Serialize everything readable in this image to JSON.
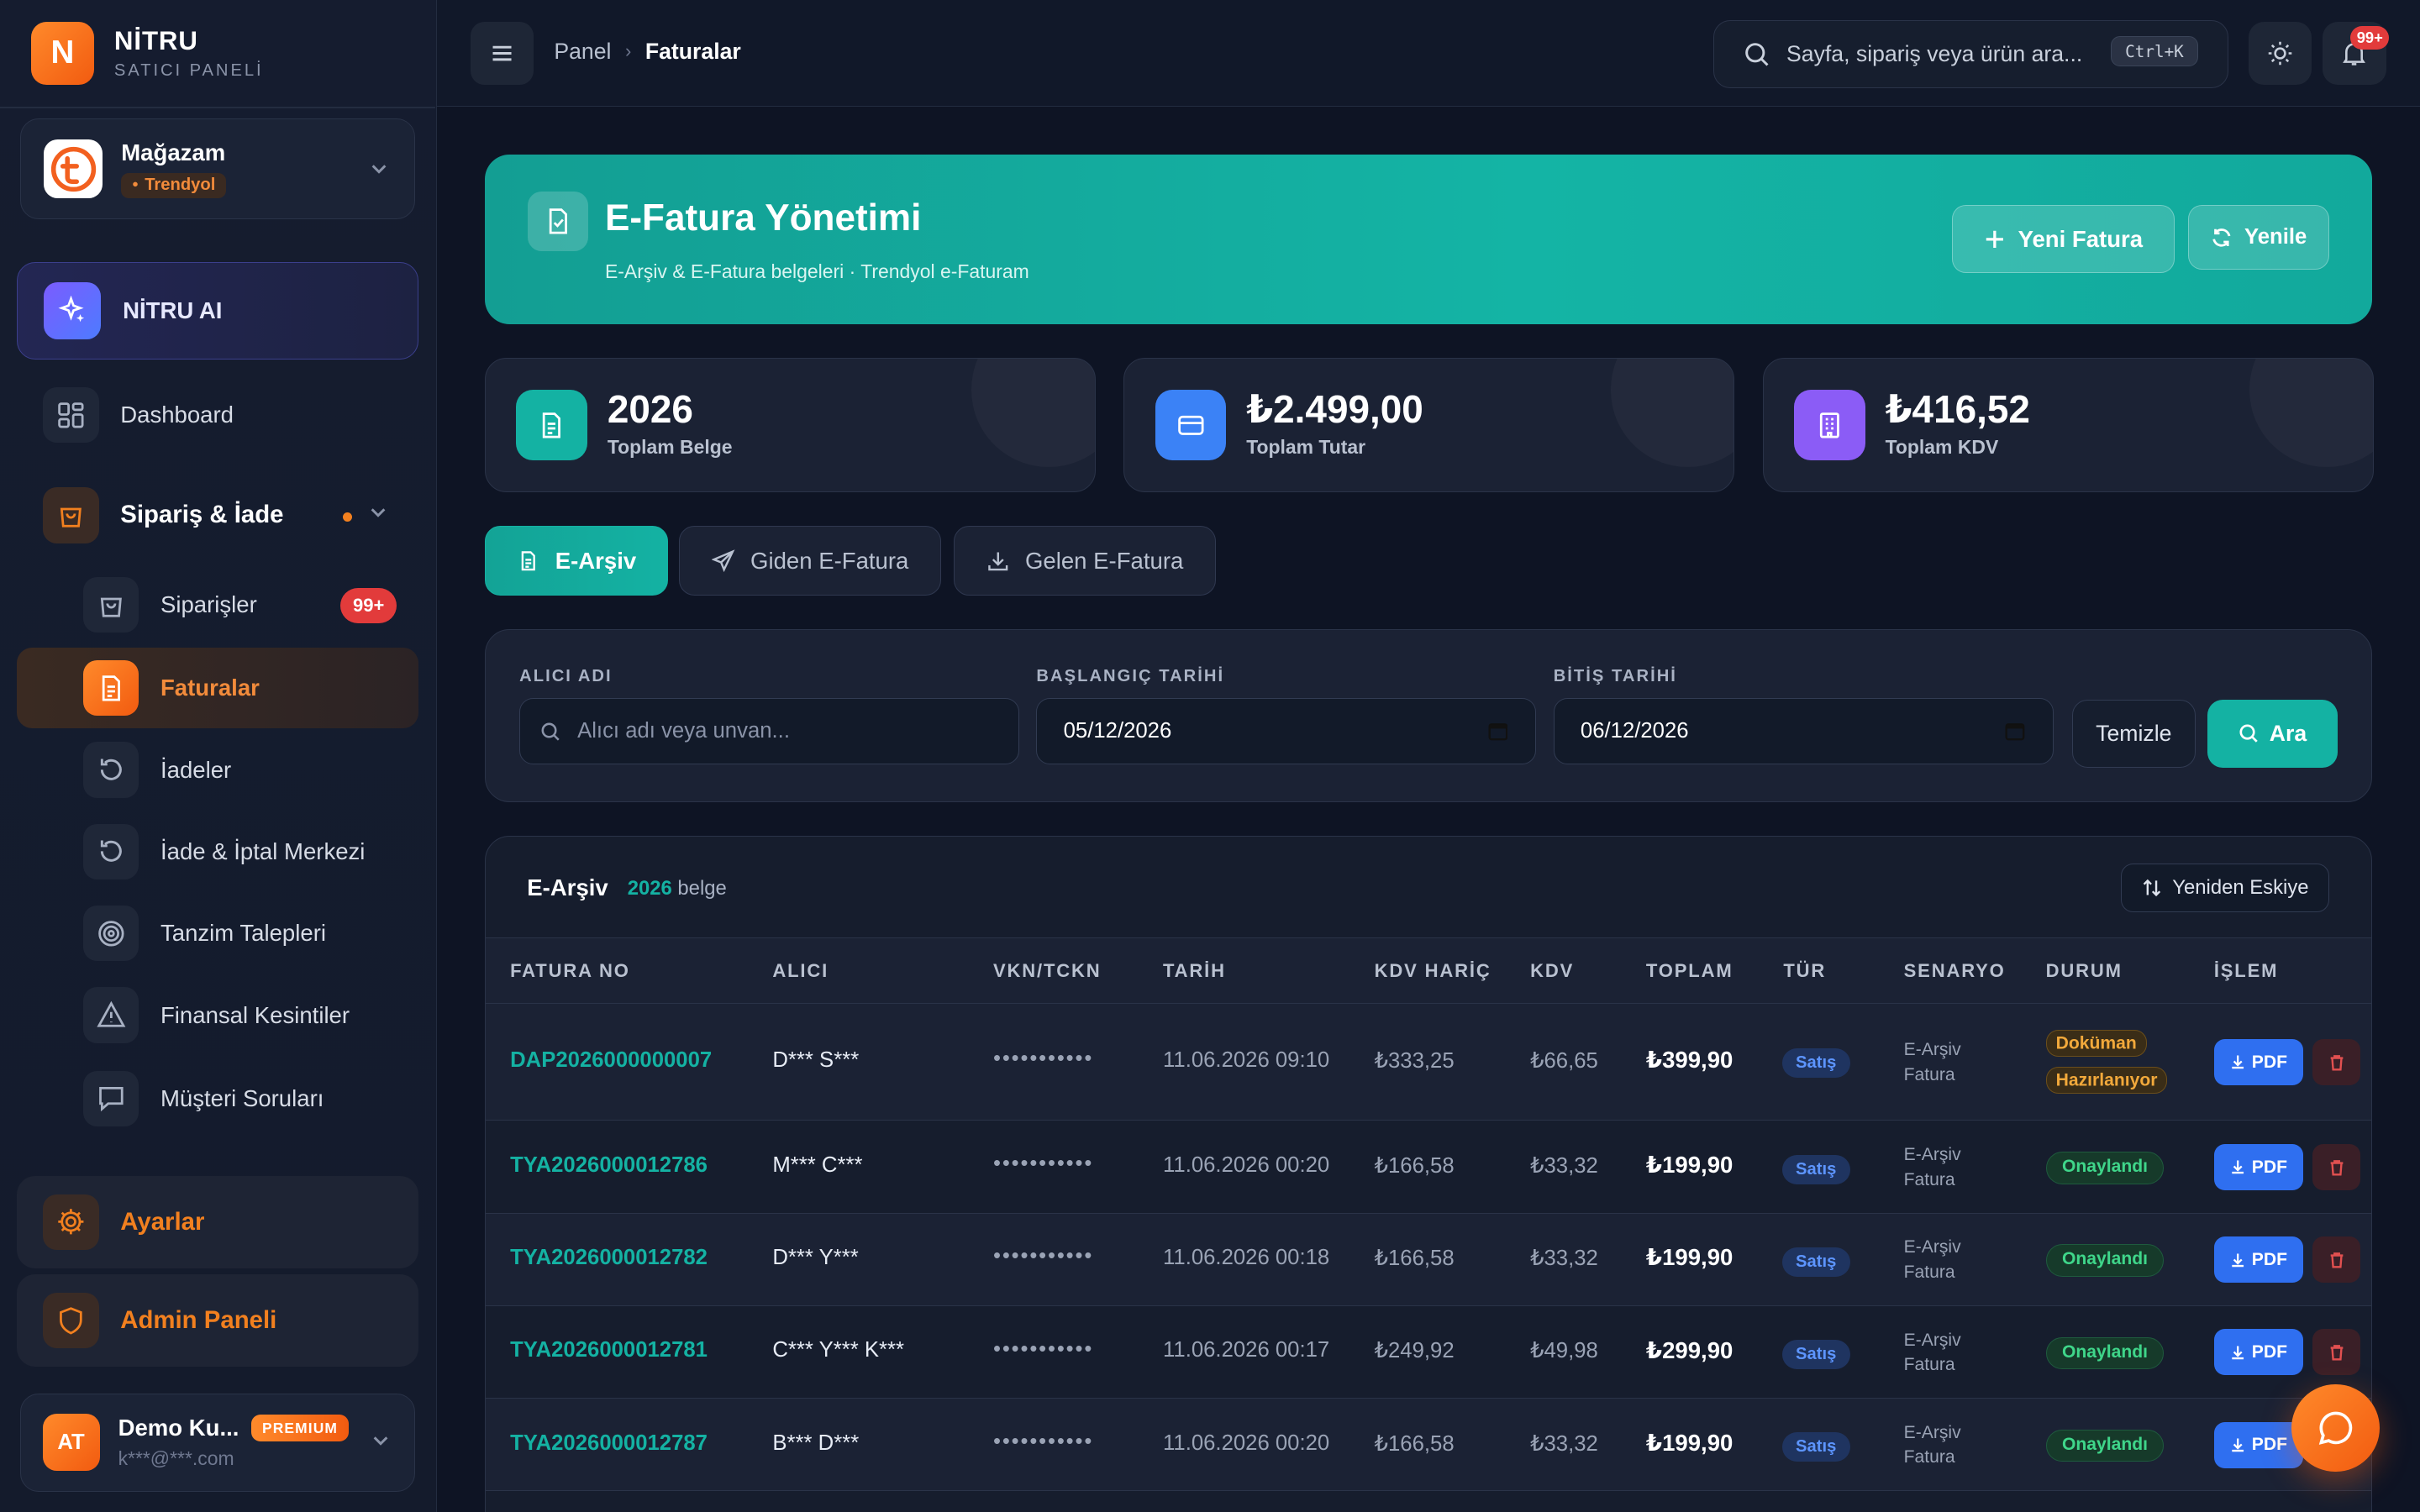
{
  "brand": {
    "logo_letter": "N",
    "name": "NİTRU",
    "subtitle": "SATICI PANELİ"
  },
  "store": {
    "name": "Mağazam",
    "platform": "Trendyol"
  },
  "sidebar": {
    "ai": {
      "label": "NİTRU AI"
    },
    "dashboard": {
      "label": "Dashboard"
    },
    "group": {
      "label": "Sipariş & İade"
    },
    "items": [
      {
        "label": "Siparişler",
        "badge": "99+"
      },
      {
        "label": "Faturalar"
      },
      {
        "label": "İadeler"
      },
      {
        "label": "İade & İptal Merkezi"
      },
      {
        "label": "Tanzim Talepleri"
      },
      {
        "label": "Finansal Kesintiler"
      },
      {
        "label": "Müşteri Soruları"
      }
    ],
    "settings": {
      "label": "Ayarlar"
    },
    "admin": {
      "label": "Admin Paneli"
    },
    "user": {
      "initials": "AT",
      "name": "Demo Ku...",
      "badge": "PREMIUM",
      "email": "k***@***.com"
    }
  },
  "topbar": {
    "breadcrumb": [
      "Panel",
      "Faturalar"
    ],
    "search_placeholder": "Sayfa, sipariş veya ürün ara...",
    "shortcut": "Ctrl+K",
    "notifications": "99+"
  },
  "hero": {
    "title": "E-Fatura Yönetimi",
    "subtitle": "E-Arşiv & E-Fatura belgeleri · Trendyol e-Faturam",
    "new_button": "Yeni Fatura",
    "refresh_button": "Yenile"
  },
  "stats": [
    {
      "value": "2026",
      "label": "Toplam Belge",
      "color": "#14b2a3"
    },
    {
      "value": "₺2.499,00",
      "label": "Toplam Tutar",
      "color": "#3b82f6"
    },
    {
      "value": "₺416,52",
      "label": "Toplam KDV",
      "color": "#8b5cf6"
    }
  ],
  "tabs": [
    {
      "label": "E-Arşiv",
      "active": true
    },
    {
      "label": "Giden E-Fatura",
      "active": false
    },
    {
      "label": "Gelen E-Fatura",
      "active": false
    }
  ],
  "filters": {
    "recipient_label": "ALICI ADI",
    "recipient_placeholder": "Alıcı adı veya unvan...",
    "start_label": "BAŞLANGIÇ TARİHİ",
    "start_value": "05/12/2026",
    "end_label": "BİTİŞ TARİHİ",
    "end_value": "06/12/2026",
    "clear_button": "Temizle",
    "search_button": "Ara"
  },
  "table": {
    "title": "E-Arşiv",
    "count": "2026",
    "count_suffix": "belge",
    "sort_button": "Yeniden Eskiye",
    "columns": [
      "FATURA NO",
      "ALICI",
      "VKN/TCKN",
      "TARİH",
      "KDV HARİÇ",
      "KDV",
      "TOPLAM",
      "TÜR",
      "SENARYO",
      "DURUM",
      "İŞLEM"
    ],
    "rows": [
      {
        "no": "DAP2026000000007",
        "buyer": "D*** S***",
        "vkn": "•••••••••••",
        "date": "11.06.2026 09:10",
        "net": "₺333,25",
        "vat": "₺66,65",
        "total": "₺399,90",
        "type": "Satış",
        "scenario_1": "E-Arşiv",
        "scenario_2": "Fatura",
        "status_1": "Doküman",
        "status_2": "Hazırlanıyor",
        "pdf": "PDF"
      },
      {
        "no": "TYA2026000012786",
        "buyer": "M*** C***",
        "vkn": "•••••••••••",
        "date": "11.06.2026 00:20",
        "net": "₺166,58",
        "vat": "₺33,32",
        "total": "₺199,90",
        "type": "Satış",
        "scenario_1": "E-Arşiv",
        "scenario_2": "Fatura",
        "status": "Onaylandı",
        "pdf": "PDF"
      },
      {
        "no": "TYA2026000012782",
        "buyer": "D*** Y***",
        "vkn": "•••••••••••",
        "date": "11.06.2026 00:18",
        "net": "₺166,58",
        "vat": "₺33,32",
        "total": "₺199,90",
        "type": "Satış",
        "scenario_1": "E-Arşiv",
        "scenario_2": "Fatura",
        "status": "Onaylandı",
        "pdf": "PDF"
      },
      {
        "no": "TYA2026000012781",
        "buyer": "C*** Y*** K***",
        "vkn": "•••••••••••",
        "date": "11.06.2026 00:17",
        "net": "₺249,92",
        "vat": "₺49,98",
        "total": "₺299,90",
        "type": "Satış",
        "scenario_1": "E-Arşiv",
        "scenario_2": "Fatura",
        "status": "Onaylandı",
        "pdf": "PDF"
      },
      {
        "no": "TYA2026000012787",
        "buyer": "B*** D***",
        "vkn": "•••••••••••",
        "date": "11.06.2026 00:20",
        "net": "₺166,58",
        "vat": "₺33,32",
        "total": "₺199,90",
        "type": "Satış",
        "scenario_1": "E-Arşiv",
        "scenario_2": "Fatura",
        "status": "Onaylandı",
        "pdf": "PDF"
      }
    ]
  },
  "colors": {
    "accent": "#14b2a3",
    "brand": "#f25b10",
    "success": "#3fd68a",
    "danger": "#e23b3b"
  }
}
